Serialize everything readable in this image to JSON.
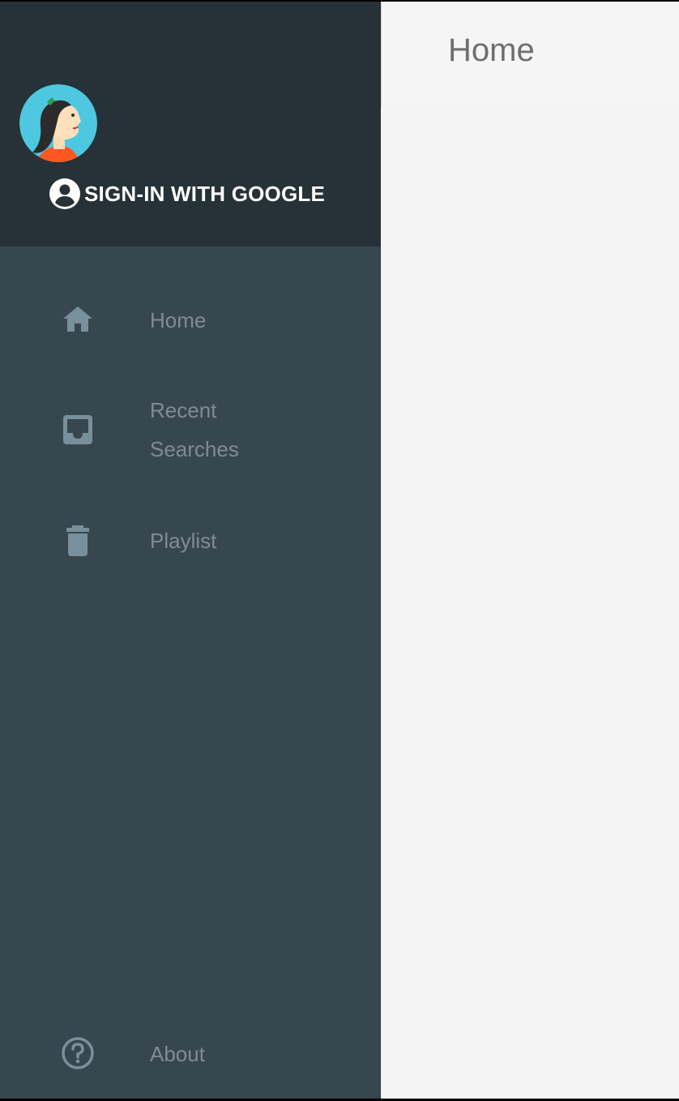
{
  "appbar": {
    "title": "Home"
  },
  "drawer": {
    "signin_label": "SIGN-IN WITH GOOGLE",
    "items": [
      {
        "label": "Home",
        "icon": "home-icon"
      },
      {
        "label": "Recent Searches",
        "icon": "inbox-icon"
      },
      {
        "label": "Playlist",
        "icon": "trash-icon"
      }
    ],
    "footer_item": {
      "label": "About",
      "icon": "help-circle-icon"
    }
  },
  "colors": {
    "drawer_header_bg": "#263238",
    "drawer_bg": "#37474f",
    "nav_text": "#7f8c93",
    "nav_icon": "#78909c",
    "appbar_bg": "#f5f5f5"
  }
}
